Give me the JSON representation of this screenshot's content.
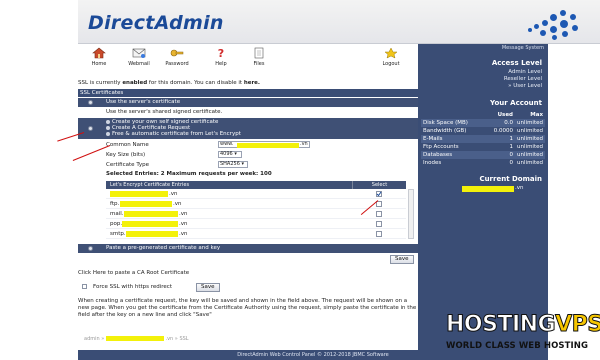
{
  "brand": {
    "logo": "DirectAdmin",
    "accent": "#1b4a98",
    "sidebar_bg": "#3a4d75"
  },
  "toolbar": [
    {
      "label": "Home",
      "icon": "home-icon"
    },
    {
      "label": "Webmail",
      "icon": "webmail-icon"
    },
    {
      "label": "Password",
      "icon": "key-icon"
    },
    {
      "label": "Help",
      "icon": "help-icon"
    },
    {
      "label": "Files",
      "icon": "files-icon"
    },
    {
      "label": "Logout",
      "icon": "logout-icon"
    }
  ],
  "sidebar": {
    "message_system": "Message System",
    "access_level_title": "Access Level",
    "levels": [
      "Admin Level",
      "Reseller Level",
      "» User Level"
    ],
    "account_title": "Your Account",
    "stats_headers": [
      "",
      "Used",
      "Max"
    ],
    "stats": [
      [
        "Disk Space (MB)",
        "0.0",
        "unlimited"
      ],
      [
        "Bandwidth (GB)",
        "0.0000",
        "unlimited"
      ],
      [
        "E-Mails",
        "1",
        "unlimited"
      ],
      [
        "Ftp Accounts",
        "1",
        "unlimited"
      ],
      [
        "Databases",
        "0",
        "unlimited"
      ],
      [
        "Inodes",
        "0",
        "unlimited"
      ]
    ],
    "current_domain_title": "Current Domain",
    "current_domain_tld": ".vn"
  },
  "main": {
    "ssl_note_prefix": "SSL is currently ",
    "ssl_note_enabled": "enabled",
    "ssl_note_mid": " for this domain. You can disable it ",
    "ssl_note_link": "here.",
    "section_header": "SSL Certificates",
    "opt_server_cert": "Use the server's certificate",
    "opt_shared_cert": "Use the server's shared signed certificate.",
    "opt_own_signed": "Create your own self signed certificate",
    "opt_request": "Create A Certificate Request",
    "opt_free_le": "Free & automatic certificate from Let's Encrypt",
    "form": {
      "common_name_label": "Common Name",
      "common_name_prefix": "www.",
      "common_name_tld": ".vn",
      "key_size_label": "Key Size (bits)",
      "key_size_value": "4096 ▾",
      "cert_type_label": "Certificate Type",
      "cert_type_value": "SHA256 ▾"
    },
    "entries_title": "Selected Entries: 2   Maximum requests per week: 100",
    "le_table_header": "Let's Encrypt Certificate Entries",
    "le_select_header": "Select",
    "le_rows": [
      {
        "prefix": "",
        "tld": ".vn",
        "checked": true
      },
      {
        "prefix": "ftp.",
        "tld": ".vn",
        "checked": false
      },
      {
        "prefix": "mail.",
        "tld": ".vn",
        "checked": false
      },
      {
        "prefix": "pop.",
        "tld": ".vn",
        "checked": false
      },
      {
        "prefix": "smtp.",
        "tld": ".vn",
        "checked": false
      }
    ],
    "opt_paste": "Paste a pre-generated certificate and key",
    "save_label": "Save",
    "ca_root_link": "Click Here to paste a CA Root Certificate",
    "force_ssl_label": "Force SSL with https redirect",
    "force_ssl_save": "Save",
    "info_text": "When creating a certificate request, the key will be saved and shown in the field above. The request will be shown on a new page. When you get the certificate from the Certificate Authority using the request, simply paste the certificate in the field after the key on a new line and click \"Save\"",
    "breadcrumb": "admin » .vn » SSL"
  },
  "footer": "DirectAdmin Web Control Panel © 2012-2018 JBMC Software",
  "watermark": {
    "part_a": "HOSTING",
    "part_b": "VPS",
    "tagline": "WORLD CLASS WEB HOSTING"
  }
}
